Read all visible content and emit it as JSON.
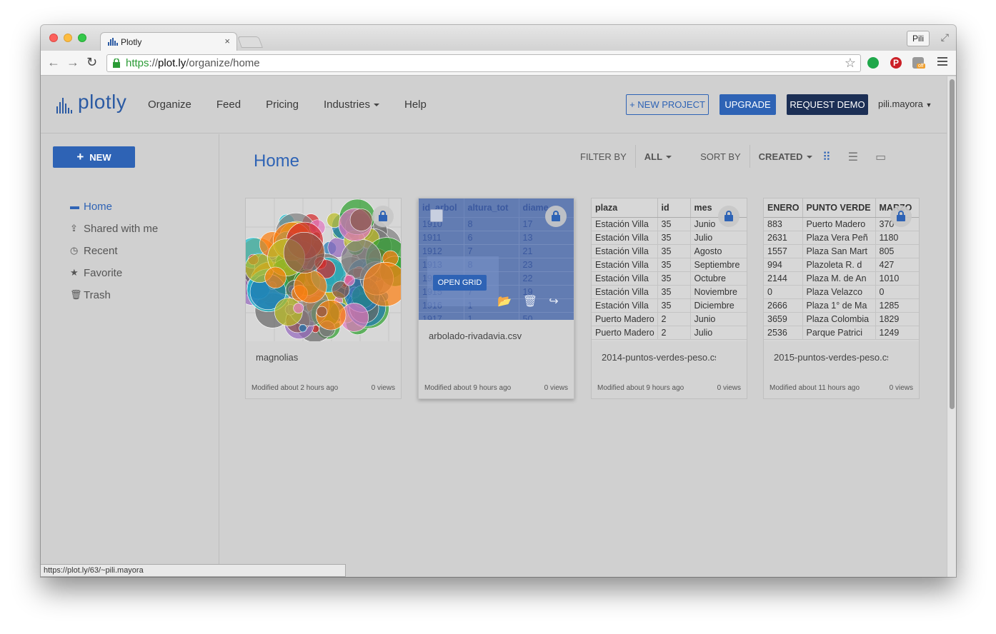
{
  "browser": {
    "tab_title": "Plotly",
    "tab_close": "×",
    "profile_label": "Pili",
    "url_scheme": "https",
    "url_sep": "://",
    "url_host": "plot.ly",
    "url_path": "/organize/home",
    "status_url": "https://plot.ly/63/~pili.mayora"
  },
  "header": {
    "logo_text": "plotly",
    "nav": [
      "Organize",
      "Feed",
      "Pricing",
      "Industries",
      "Help"
    ],
    "new_project": "NEW PROJECT",
    "upgrade": "UPGRADE",
    "request_demo": "REQUEST DEMO",
    "user": "pili.mayora"
  },
  "sidebar": {
    "new_label": "NEW",
    "items": [
      {
        "label": "Home",
        "icon": "inbox-icon",
        "active": true
      },
      {
        "label": "Shared with me",
        "icon": "shared-icon",
        "active": false
      },
      {
        "label": "Recent",
        "icon": "clock-icon",
        "active": false
      },
      {
        "label": "Favorite",
        "icon": "star-icon",
        "active": false
      },
      {
        "label": "Trash",
        "icon": "trash-icon",
        "active": false
      }
    ]
  },
  "main": {
    "title": "Home",
    "filter_label": "FILTER BY",
    "filter_value": "ALL",
    "sort_label": "SORT BY",
    "sort_value": "CREATED"
  },
  "cards": [
    {
      "name": "magnolias",
      "modified": "Modified about 2 hours ago",
      "views": "0 views"
    },
    {
      "name": "arbolado-rivadavia.csv",
      "modified": "Modified about 9 hours ago",
      "views": "0 views",
      "open_label": "OPEN GRID"
    },
    {
      "name": "2014-puntos-verdes-peso.csv",
      "modified": "Modified about 9 hours ago",
      "views": "0 views"
    },
    {
      "name": "2015-puntos-verdes-peso.csv",
      "modified": "Modified about 11 hours ago",
      "views": "0 views"
    }
  ],
  "grid_arbolado": {
    "headers": [
      "id_arbol",
      "altura_tot",
      "diame"
    ],
    "rows": [
      [
        "1910",
        "8",
        "17"
      ],
      [
        "1911",
        "6",
        "13"
      ],
      [
        "1912",
        "7",
        "21"
      ],
      [
        "1913",
        "8",
        "23"
      ],
      [
        "19",
        "",
        "22"
      ],
      [
        "1915",
        "7",
        "19"
      ],
      [
        "1916",
        "1",
        ""
      ],
      [
        "1917",
        "1",
        "50"
      ]
    ]
  },
  "grid_2014": {
    "headers": [
      "plaza",
      "id",
      "mes"
    ],
    "rows": [
      [
        "Estación Villa",
        "35",
        "Junio"
      ],
      [
        "Estación Villa",
        "35",
        "Julio"
      ],
      [
        "Estación Villa",
        "35",
        "Agosto"
      ],
      [
        "Estación Villa",
        "35",
        "Septiembre"
      ],
      [
        "Estación Villa",
        "35",
        "Octubre"
      ],
      [
        "Estación Villa",
        "35",
        "Noviembre"
      ],
      [
        "Estación Villa",
        "35",
        "Diciembre"
      ],
      [
        "Puerto Madero",
        "2",
        "Junio"
      ],
      [
        "Puerto Madero",
        "2",
        "Julio"
      ]
    ]
  },
  "grid_2015": {
    "headers": [
      "ENERO",
      "PUNTO VERDE",
      "MARZO"
    ],
    "rows": [
      [
        "883",
        "Puerto Madero",
        "370"
      ],
      [
        "2631",
        "Plaza Vera Peñ",
        "1180"
      ],
      [
        "1557",
        "Plaza San Mart",
        "805"
      ],
      [
        "994",
        "Plazoleta R. d",
        "427"
      ],
      [
        "2144",
        "Plaza M. de An",
        "1010"
      ],
      [
        "0",
        "Plaza Velazco",
        "0"
      ],
      [
        "2666",
        "Plaza 1° de Ma",
        "1285"
      ],
      [
        "3659",
        "Plaza Colombia",
        "1829"
      ],
      [
        "2536",
        "Parque Patrici",
        "1249"
      ]
    ]
  },
  "colors": {
    "brand_blue": "#2e63b5",
    "demo_navy": "#1c2f55"
  }
}
